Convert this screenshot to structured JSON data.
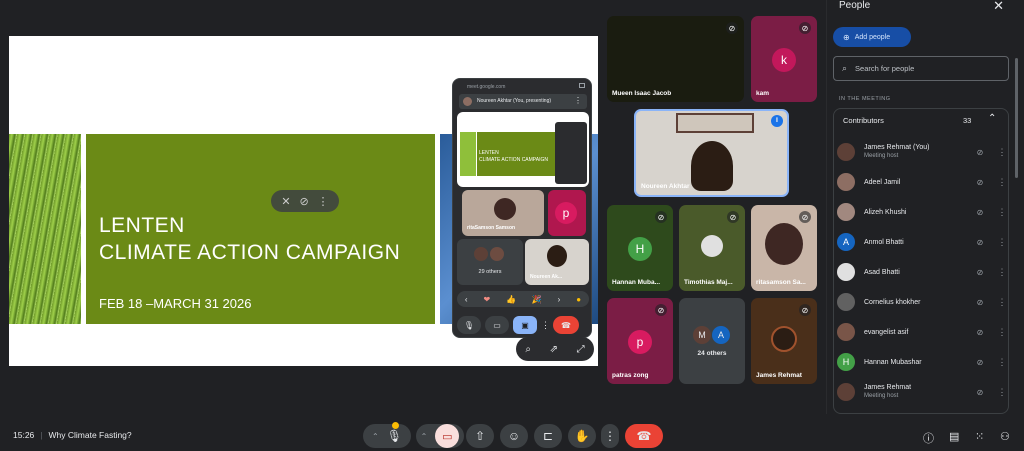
{
  "slide": {
    "title_line1": "LENTEN",
    "title_line2": "CLIMATE ACTION CAMPAIGN",
    "dates": "FEB 18 –MARCH 31 2026"
  },
  "pip": {
    "url": "meet.google.com",
    "presenter": "Noureen Akhtar (You, presenting)",
    "mini_slide_line1": "LENTEN",
    "mini_slide_line2": "CLIMATE ACTION CAMPAIGN",
    "tile_a_label": "ritaSamson Samson",
    "tile_b_letter": "p",
    "others_label": "29 others",
    "tile_c_label": "Noureen Ak...",
    "reactions": [
      "❤",
      "👍",
      "🎉"
    ]
  },
  "grid": [
    {
      "name": "Mueen Isaac Jacob",
      "color": "#1a1c10"
    },
    {
      "name": "kam",
      "letter": "k",
      "color": "#7b1d45",
      "avatar": "#c2185b"
    },
    {
      "name": "Noureen Akhtar",
      "color": "#d7d3cd"
    },
    {
      "name": "Hannan Muba...",
      "letter": "H",
      "color": "#2e4a1c",
      "avatar": "#43a047"
    },
    {
      "name": "Timothias Maj...",
      "color": "#4a5a2a"
    },
    {
      "name": "ritasamson Sa...",
      "color": "#c9b6a8"
    },
    {
      "name": "patras zong",
      "letter": "p",
      "color": "#7b1d45",
      "avatar": "#d81b60"
    },
    {
      "name": "24 others",
      "color": "#3c4043"
    },
    {
      "name": "James Rehmat",
      "color": "#4a2f1a"
    }
  ],
  "people": {
    "title": "People",
    "add_label": "Add people",
    "search_placeholder": "Search for people",
    "section": "IN THE MEETING",
    "contributors_label": "Contributors",
    "contributors_count": "33",
    "list": [
      {
        "name": "James Rehmat (You)",
        "sub": "Meeting host",
        "color": "#5d4037"
      },
      {
        "name": "Adeel Jamil",
        "sub": "",
        "color": "#8d6e63"
      },
      {
        "name": "Alizeh Khushi",
        "sub": "",
        "color": "#a1887f"
      },
      {
        "name": "Anmol Bhatti",
        "sub": "",
        "letter": "A",
        "color": "#1565c0"
      },
      {
        "name": "Asad Bhatti",
        "sub": "",
        "color": "#e0e0e0"
      },
      {
        "name": "Cornelius khokher",
        "sub": "",
        "color": "#616161"
      },
      {
        "name": "evangelist asif",
        "sub": "",
        "color": "#795548"
      },
      {
        "name": "Hannan Mubashar",
        "sub": "",
        "letter": "H",
        "color": "#43a047"
      },
      {
        "name": "James Rehmat",
        "sub": "Meeting host",
        "color": "#5d4037"
      }
    ]
  },
  "bottom": {
    "time": "15:26",
    "meeting_title": "Why Climate Fasting?"
  }
}
